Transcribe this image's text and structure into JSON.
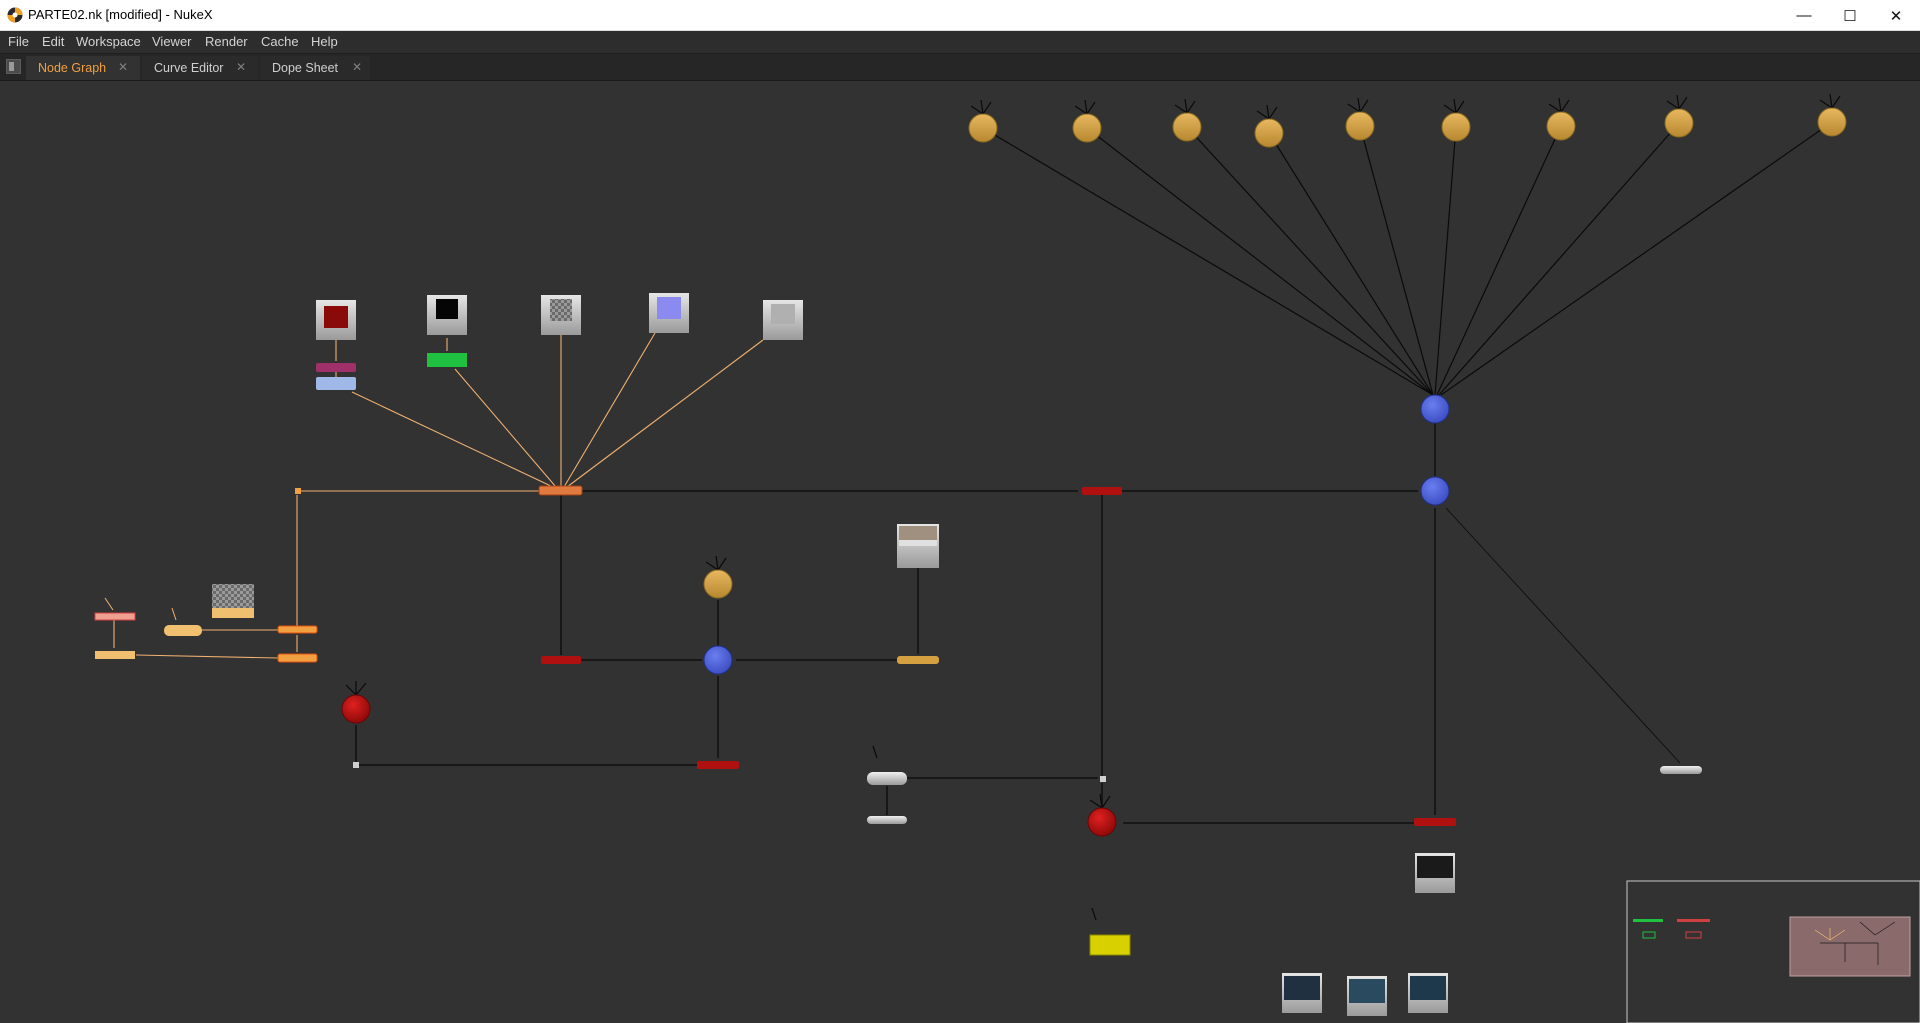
{
  "window": {
    "title": "PARTE02.nk [modified] - NukeX",
    "controls": {
      "minimize": "—",
      "maximize": "☐",
      "close": "✕"
    }
  },
  "menu": [
    "File",
    "Edit",
    "Workspace",
    "Viewer",
    "Render",
    "Cache",
    "Help"
  ],
  "tabs": [
    {
      "label": "Node Graph",
      "active": true
    },
    {
      "label": "Curve Editor",
      "active": false
    },
    {
      "label": "Dope Sheet",
      "active": false
    }
  ],
  "icons": {
    "app": "nuke-logo-icon",
    "tab_close": "close-icon",
    "pane_menu": "pane-menu-icon"
  },
  "colors": {
    "graph_background": "#323232",
    "active_tab_text": "#f0a040",
    "camera_node": "#d4a04a",
    "scene_node": "#4a5fd0",
    "render_node": "#b01010",
    "texture_pipe": "#f0b070",
    "edge": "#0a0a0a"
  }
}
